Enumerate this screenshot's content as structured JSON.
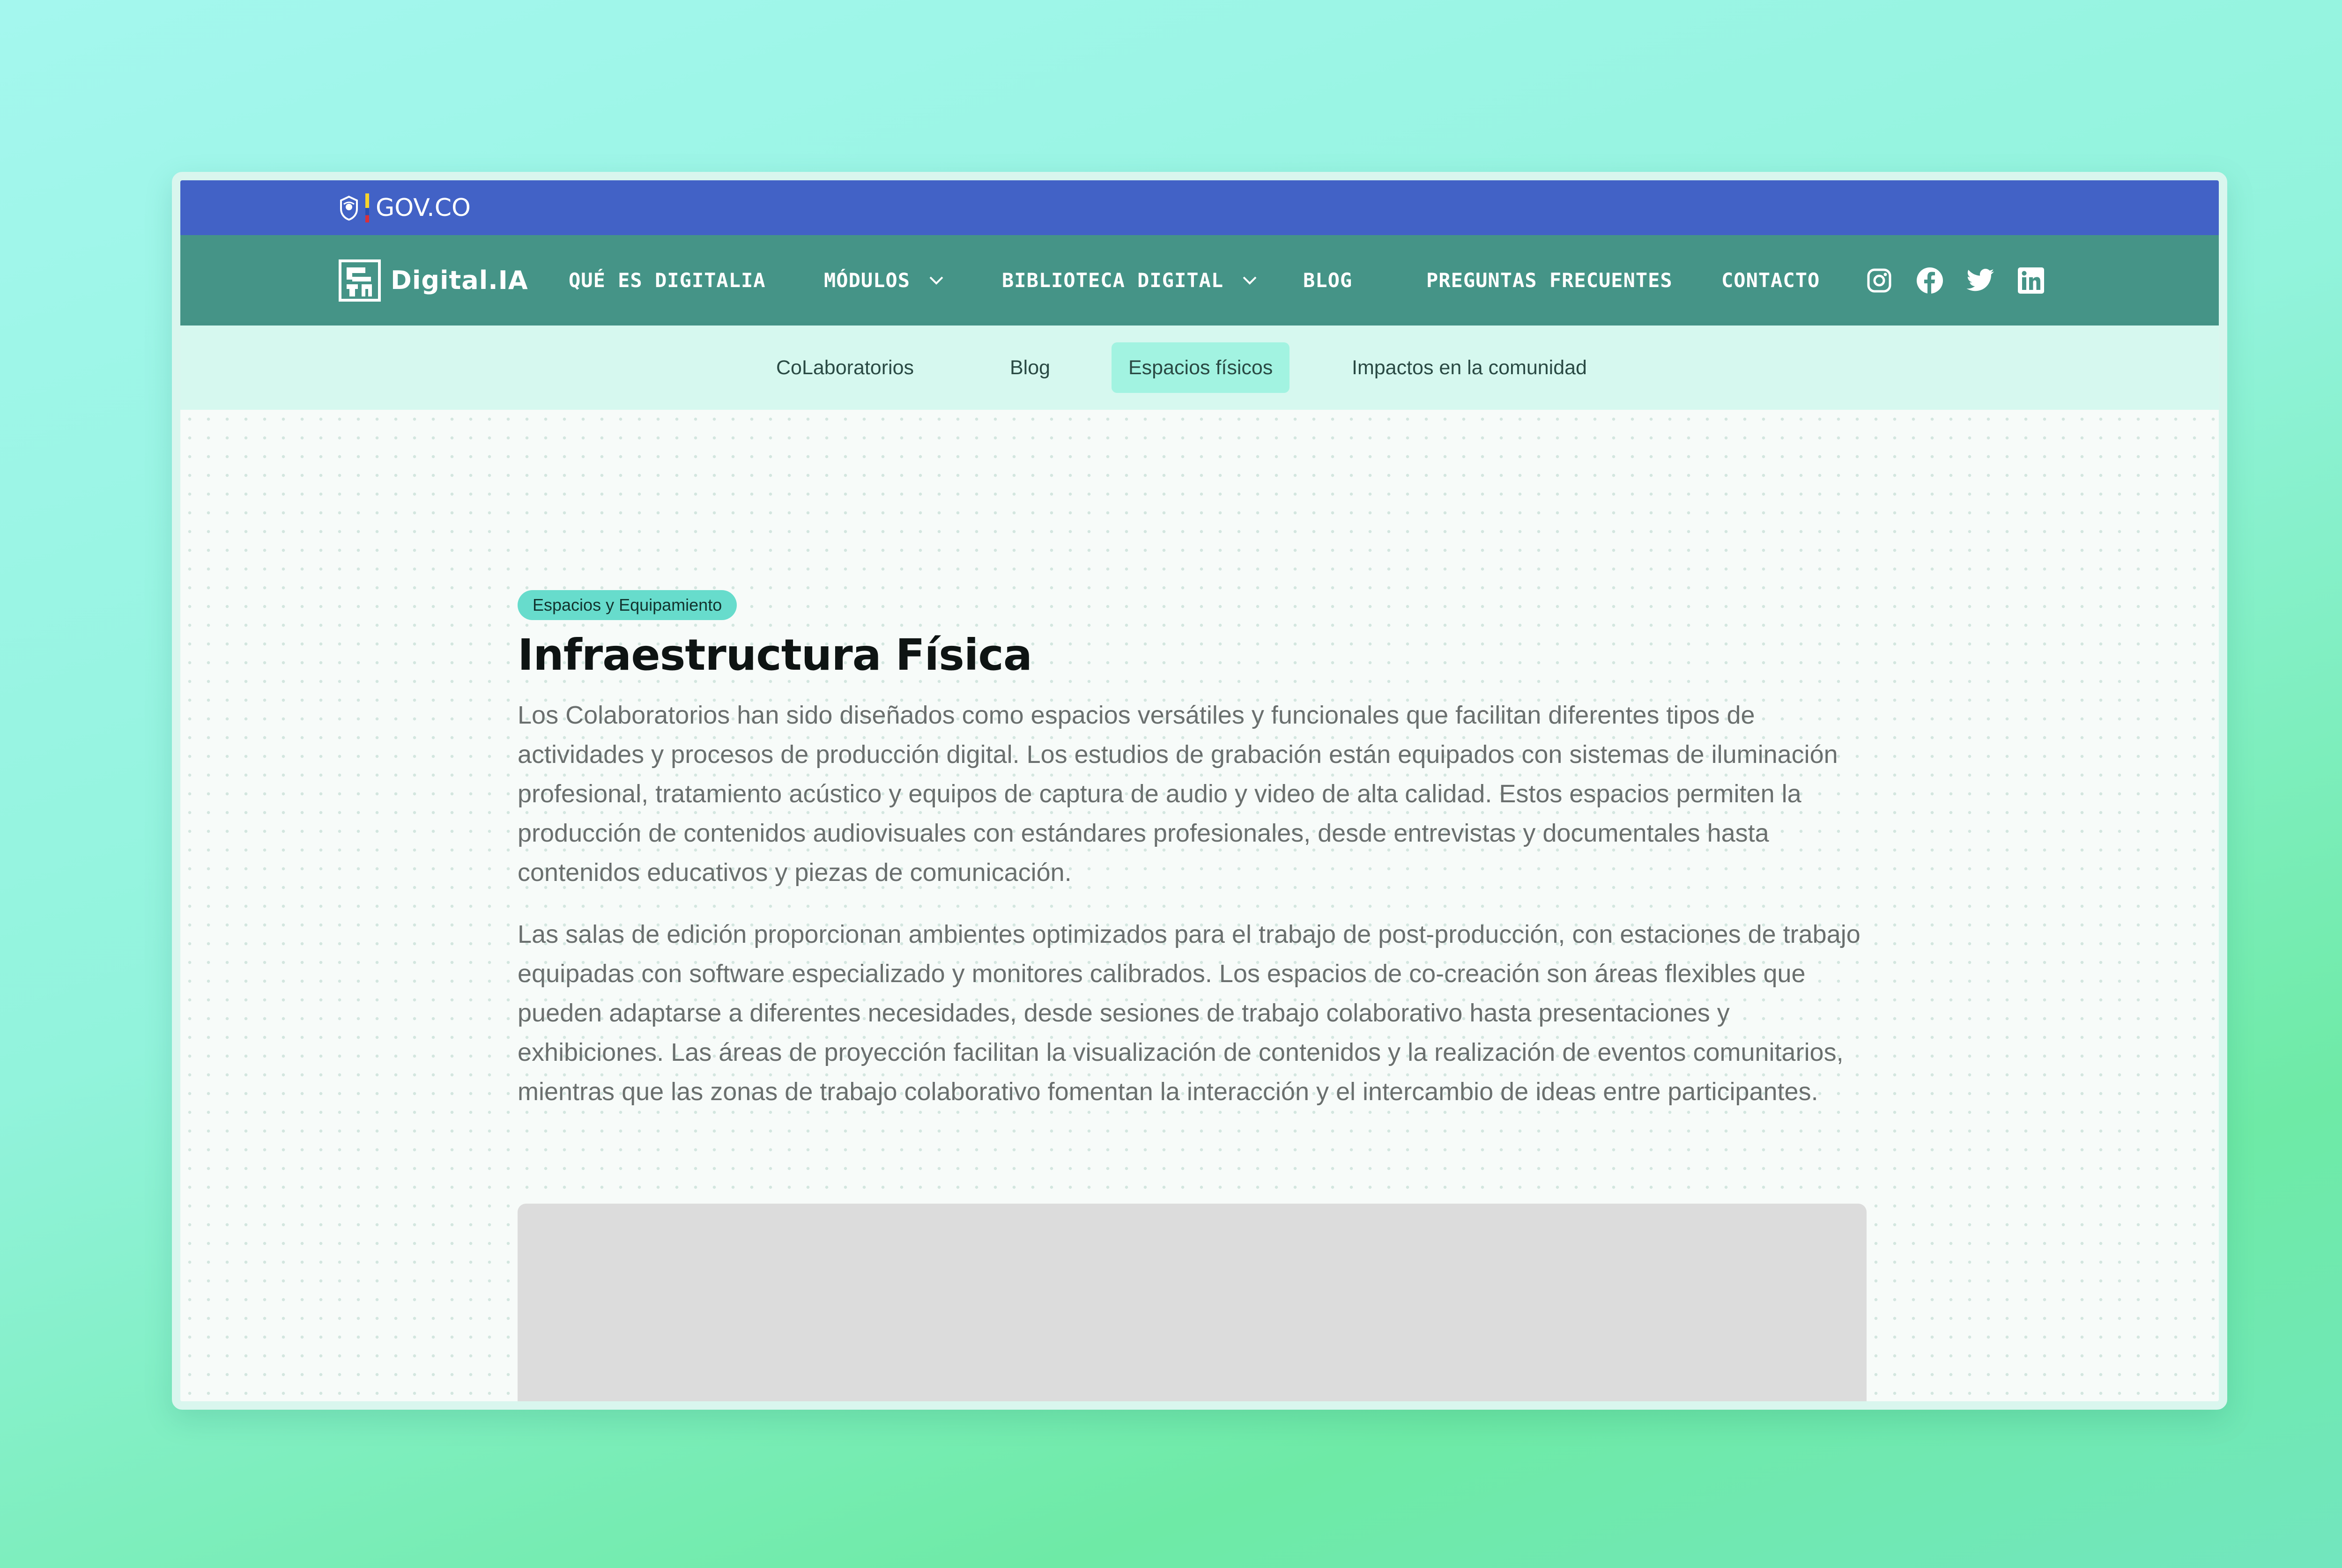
{
  "gov_bar": {
    "logo_text": "GOV.CO",
    "seal_icon": "colombia-seal-icon",
    "color": "#4262c6"
  },
  "main_nav": {
    "brand": {
      "name": "Digital.IA",
      "icon": "digital-ia-logo-icon"
    },
    "items": [
      {
        "label": "QUÉ ES DIGITALIA",
        "has_dropdown": false
      },
      {
        "label": "MÓDULOS",
        "has_dropdown": true
      },
      {
        "label": "BIBLIOTECA DIGITAL",
        "has_dropdown": true
      },
      {
        "label": "BLOG",
        "has_dropdown": false
      },
      {
        "label": "PREGUNTAS FRECUENTES",
        "has_dropdown": false
      },
      {
        "label": "CONTACTO",
        "has_dropdown": false
      }
    ],
    "socials": [
      "instagram-icon",
      "facebook-icon",
      "twitter-icon",
      "linkedin-icon"
    ],
    "color": "#459487"
  },
  "sub_nav": {
    "items": [
      {
        "label": "CoLaboratorios",
        "active": false
      },
      {
        "label": "Blog",
        "active": false
      },
      {
        "label": "Espacios físicos",
        "active": true
      },
      {
        "label": "Impactos en la comunidad",
        "active": false
      }
    ],
    "active_color": "#a2f3e1"
  },
  "article": {
    "tag": "Espacios y Equipamiento",
    "title": "Infraestructura Física",
    "paragraphs": [
      "Los Colaboratorios han sido diseñados como espacios versátiles y funcionales que facilitan diferentes tipos de actividades y procesos de producción digital. Los estudios de grabación están equipados con sistemas de iluminación profesional, tratamiento acústico y equipos de captura de audio y video de alta calidad. Estos espacios permiten la producción de contenidos audiovisuales con estándares profesionales, desde entrevistas y documentales hasta contenidos educativos y piezas de comunicación.",
      "Las salas de edición proporcionan ambientes optimizados para el trabajo de post-producción, con estaciones de trabajo equipadas con software especializado y monitores calibrados. Los espacios de co-creación son áreas flexibles que pueden adaptarse a diferentes necesidades, desde sesiones de trabajo colaborativo hasta presentaciones y exhibiciones. Las áreas de proyección facilitan la visualización de contenidos y la realización de eventos comunitarios, mientras que las zonas de trabajo colaborativo fomentan la interacción y el intercambio de ideas entre participantes."
    ],
    "tag_color": "#67dccc"
  }
}
